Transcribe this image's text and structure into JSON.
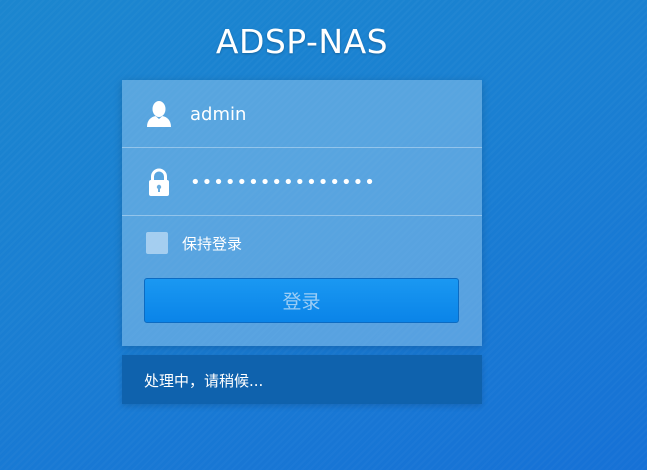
{
  "app": {
    "title": "ADSP-NAS"
  },
  "login": {
    "username_value": "admin",
    "username_icon": "user-icon",
    "password_value": "••••••••••••••••",
    "password_icon": "lock-icon",
    "remember_label": "保持登录",
    "remember_checked": false,
    "login_button_label": "登录"
  },
  "status": {
    "message": "处理中，请稍候..."
  },
  "colors": {
    "background": "#1a7fd2",
    "panel": "#8cc3eb",
    "button": "#0a84e8",
    "status_bar": "#0f62ad"
  }
}
